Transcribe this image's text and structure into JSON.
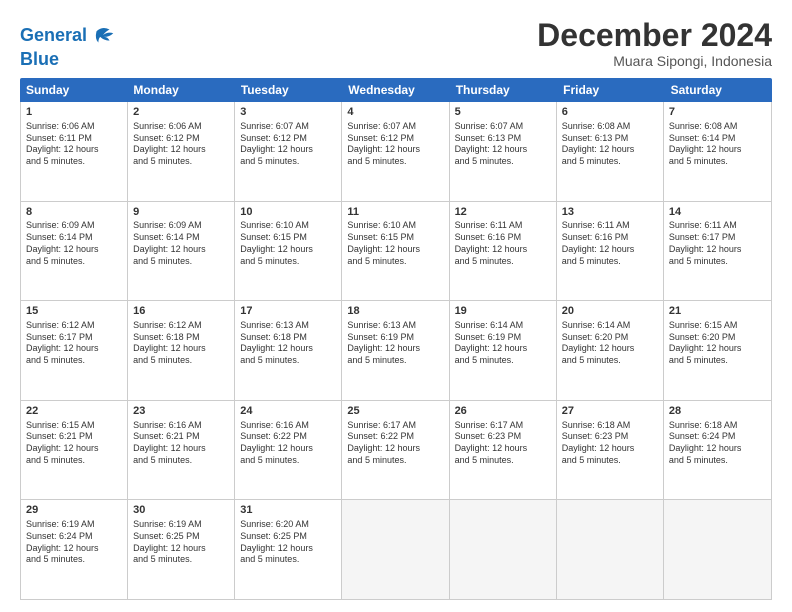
{
  "logo": {
    "line1": "General",
    "line2": "Blue"
  },
  "title": "December 2024",
  "location": "Muara Sipongi, Indonesia",
  "headers": [
    "Sunday",
    "Monday",
    "Tuesday",
    "Wednesday",
    "Thursday",
    "Friday",
    "Saturday"
  ],
  "rows": [
    [
      {
        "day": "1",
        "info": "Sunrise: 6:06 AM\nSunset: 6:11 PM\nDaylight: 12 hours\nand 5 minutes."
      },
      {
        "day": "2",
        "info": "Sunrise: 6:06 AM\nSunset: 6:12 PM\nDaylight: 12 hours\nand 5 minutes."
      },
      {
        "day": "3",
        "info": "Sunrise: 6:07 AM\nSunset: 6:12 PM\nDaylight: 12 hours\nand 5 minutes."
      },
      {
        "day": "4",
        "info": "Sunrise: 6:07 AM\nSunset: 6:12 PM\nDaylight: 12 hours\nand 5 minutes."
      },
      {
        "day": "5",
        "info": "Sunrise: 6:07 AM\nSunset: 6:13 PM\nDaylight: 12 hours\nand 5 minutes."
      },
      {
        "day": "6",
        "info": "Sunrise: 6:08 AM\nSunset: 6:13 PM\nDaylight: 12 hours\nand 5 minutes."
      },
      {
        "day": "7",
        "info": "Sunrise: 6:08 AM\nSunset: 6:14 PM\nDaylight: 12 hours\nand 5 minutes."
      }
    ],
    [
      {
        "day": "8",
        "info": "Sunrise: 6:09 AM\nSunset: 6:14 PM\nDaylight: 12 hours\nand 5 minutes."
      },
      {
        "day": "9",
        "info": "Sunrise: 6:09 AM\nSunset: 6:14 PM\nDaylight: 12 hours\nand 5 minutes."
      },
      {
        "day": "10",
        "info": "Sunrise: 6:10 AM\nSunset: 6:15 PM\nDaylight: 12 hours\nand 5 minutes."
      },
      {
        "day": "11",
        "info": "Sunrise: 6:10 AM\nSunset: 6:15 PM\nDaylight: 12 hours\nand 5 minutes."
      },
      {
        "day": "12",
        "info": "Sunrise: 6:11 AM\nSunset: 6:16 PM\nDaylight: 12 hours\nand 5 minutes."
      },
      {
        "day": "13",
        "info": "Sunrise: 6:11 AM\nSunset: 6:16 PM\nDaylight: 12 hours\nand 5 minutes."
      },
      {
        "day": "14",
        "info": "Sunrise: 6:11 AM\nSunset: 6:17 PM\nDaylight: 12 hours\nand 5 minutes."
      }
    ],
    [
      {
        "day": "15",
        "info": "Sunrise: 6:12 AM\nSunset: 6:17 PM\nDaylight: 12 hours\nand 5 minutes."
      },
      {
        "day": "16",
        "info": "Sunrise: 6:12 AM\nSunset: 6:18 PM\nDaylight: 12 hours\nand 5 minutes."
      },
      {
        "day": "17",
        "info": "Sunrise: 6:13 AM\nSunset: 6:18 PM\nDaylight: 12 hours\nand 5 minutes."
      },
      {
        "day": "18",
        "info": "Sunrise: 6:13 AM\nSunset: 6:19 PM\nDaylight: 12 hours\nand 5 minutes."
      },
      {
        "day": "19",
        "info": "Sunrise: 6:14 AM\nSunset: 6:19 PM\nDaylight: 12 hours\nand 5 minutes."
      },
      {
        "day": "20",
        "info": "Sunrise: 6:14 AM\nSunset: 6:20 PM\nDaylight: 12 hours\nand 5 minutes."
      },
      {
        "day": "21",
        "info": "Sunrise: 6:15 AM\nSunset: 6:20 PM\nDaylight: 12 hours\nand 5 minutes."
      }
    ],
    [
      {
        "day": "22",
        "info": "Sunrise: 6:15 AM\nSunset: 6:21 PM\nDaylight: 12 hours\nand 5 minutes."
      },
      {
        "day": "23",
        "info": "Sunrise: 6:16 AM\nSunset: 6:21 PM\nDaylight: 12 hours\nand 5 minutes."
      },
      {
        "day": "24",
        "info": "Sunrise: 6:16 AM\nSunset: 6:22 PM\nDaylight: 12 hours\nand 5 minutes."
      },
      {
        "day": "25",
        "info": "Sunrise: 6:17 AM\nSunset: 6:22 PM\nDaylight: 12 hours\nand 5 minutes."
      },
      {
        "day": "26",
        "info": "Sunrise: 6:17 AM\nSunset: 6:23 PM\nDaylight: 12 hours\nand 5 minutes."
      },
      {
        "day": "27",
        "info": "Sunrise: 6:18 AM\nSunset: 6:23 PM\nDaylight: 12 hours\nand 5 minutes."
      },
      {
        "day": "28",
        "info": "Sunrise: 6:18 AM\nSunset: 6:24 PM\nDaylight: 12 hours\nand 5 minutes."
      }
    ],
    [
      {
        "day": "29",
        "info": "Sunrise: 6:19 AM\nSunset: 6:24 PM\nDaylight: 12 hours\nand 5 minutes."
      },
      {
        "day": "30",
        "info": "Sunrise: 6:19 AM\nSunset: 6:25 PM\nDaylight: 12 hours\nand 5 minutes."
      },
      {
        "day": "31",
        "info": "Sunrise: 6:20 AM\nSunset: 6:25 PM\nDaylight: 12 hours\nand 5 minutes."
      },
      {
        "day": "",
        "info": ""
      },
      {
        "day": "",
        "info": ""
      },
      {
        "day": "",
        "info": ""
      },
      {
        "day": "",
        "info": ""
      }
    ]
  ]
}
